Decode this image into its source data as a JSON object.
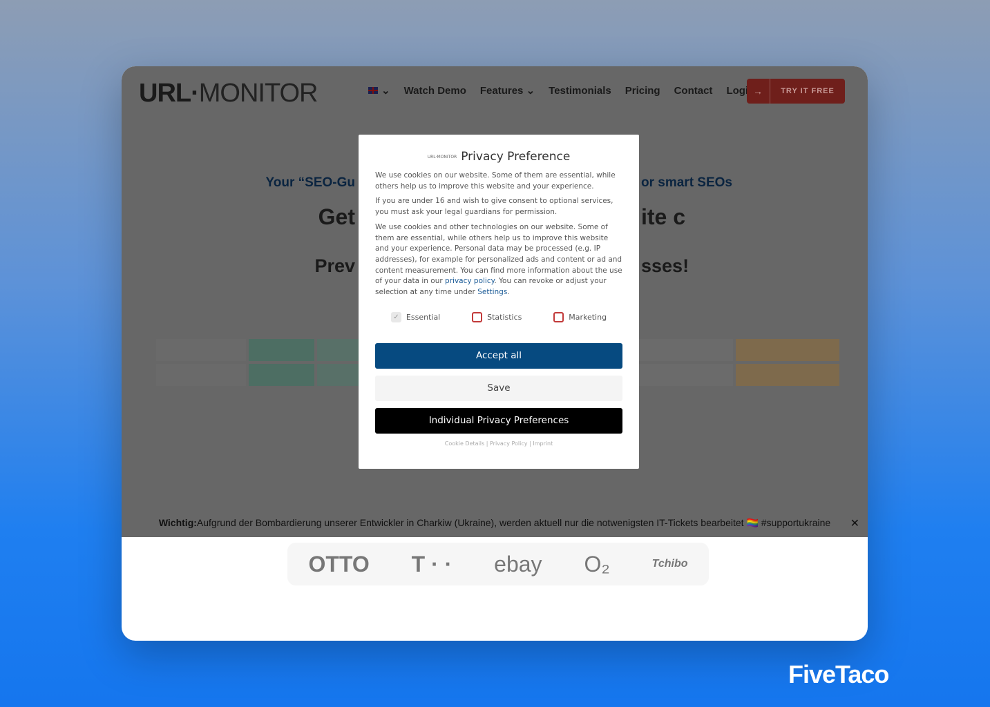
{
  "nav": {
    "logo": "URL-MONITOR",
    "logo_a": "URL·",
    "logo_b": "MONITOR",
    "items": [
      "Watch Demo",
      "Features ⌄",
      "Testimonials",
      "Pricing",
      "Contact",
      "Login"
    ],
    "lang": "⌄",
    "cta": "TRY IT FREE",
    "cta_icon": "→"
  },
  "hero": {
    "sub_left": "Your “SEO-Gu",
    "sub_right": "or smart SEOs",
    "h1_left": "Get",
    "h1_right": "ite c",
    "h1b_left": "Prev",
    "h1b_right": "sses!"
  },
  "brands": [
    "OTTO",
    "T · ·",
    "ebay",
    "O₂",
    "Tchibo"
  ],
  "banner": {
    "bold": "Wichtig:",
    "text": " Aufgrund der Bombardierung unserer Entwickler in Charkiw (Ukraine), werden aktuell nur die notwenigsten IT-Tickets bearbeitet 🏳️‍🌈 #supportukraine",
    "close": "✕"
  },
  "modal": {
    "logo": "URL·MONITOR",
    "title": "Privacy Preference",
    "p1": "We use cookies on our website. Some of them are essential, while others help us to improve this website and your experience.",
    "p2": "If you are under 16 and wish to give consent to optional services, you must ask your legal guardians for permission.",
    "p3a": "We use cookies and other technologies on our website. Some of them are essential, while others help us to improve this website and your experience. Personal data may be processed (e.g. IP addresses), for example for personalized ads and content or ad and content measurement. You can find more information about the use of your data in our ",
    "p3link": "privacy policy",
    "p3b": ". You can revoke or adjust your selection at any time under ",
    "p3link2": "Settings",
    "p3c": ".",
    "checks": [
      {
        "label": "Essential",
        "checked": true
      },
      {
        "label": "Statistics",
        "checked": false
      },
      {
        "label": "Marketing",
        "checked": false
      }
    ],
    "accept": "Accept all",
    "save": "Save",
    "individual": "Individual Privacy Preferences",
    "links": [
      "Cookie Details",
      "Privacy Policy",
      "Imprint"
    ],
    "sep": "|"
  },
  "brand_footer": "FiveTaco",
  "colors": {
    "accent": "#064a80",
    "cta": "#c2271f"
  }
}
